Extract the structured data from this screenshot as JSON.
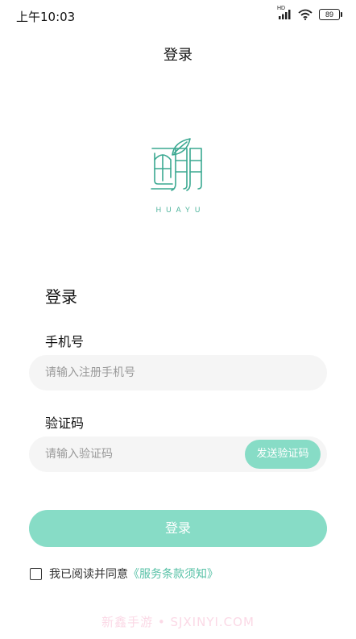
{
  "status_bar": {
    "time": "上午10:03",
    "network_label": "HD",
    "battery_level": "89",
    "icons": [
      "signal-icon",
      "wifi-icon",
      "battery-icon"
    ]
  },
  "header": {
    "title": "登录"
  },
  "logo": {
    "subtitle": "HUAYU",
    "color": "#3aa891"
  },
  "form": {
    "title": "登录",
    "phone_label": "手机号",
    "phone_placeholder": "请输入注册手机号",
    "phone_value": "",
    "code_label": "验证码",
    "code_placeholder": "请输入验证码",
    "code_value": "",
    "send_code_label": "发送验证码",
    "submit_label": "登录"
  },
  "agreement": {
    "checked": false,
    "text": "我已阅读并同意",
    "link": "《服务条款须知》"
  },
  "watermark": "新鑫手游 • SJXINYI.COM",
  "colors": {
    "accent": "#87dcc6",
    "link": "#57c1a6",
    "input_bg": "#f5f5f5"
  }
}
